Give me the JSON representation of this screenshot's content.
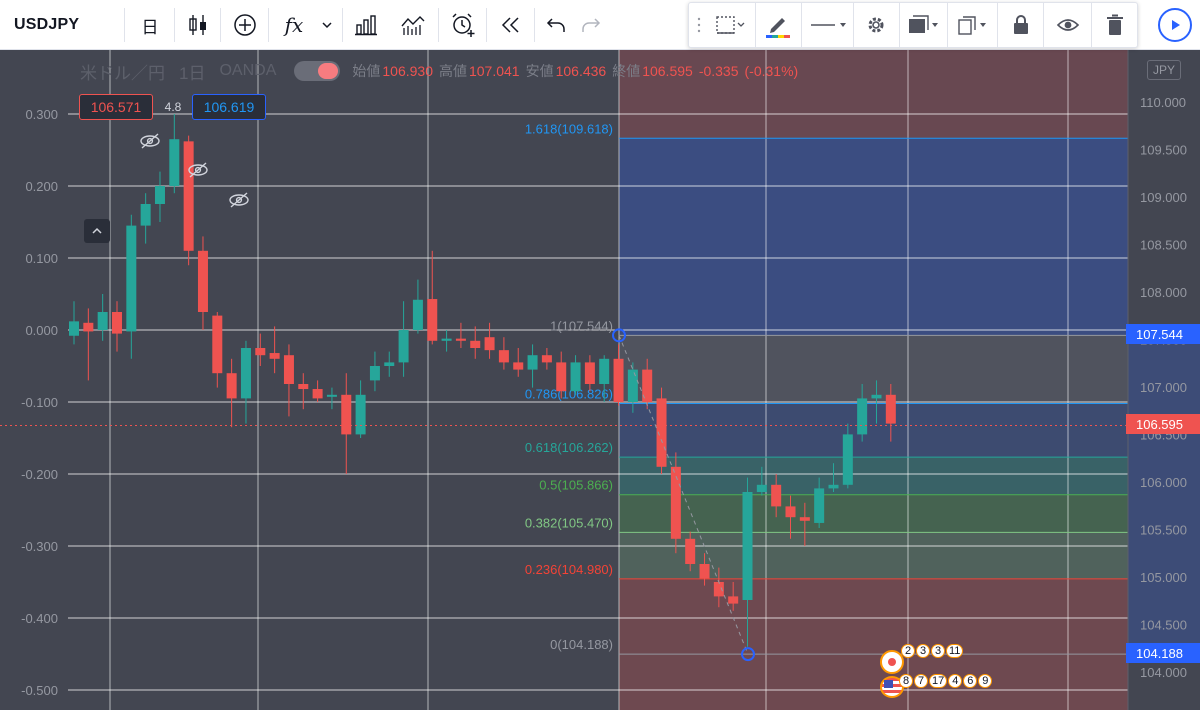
{
  "toolbar": {
    "symbol": "USDJPY",
    "interval": "日",
    "fx_label": "fx"
  },
  "legend": {
    "pair": "米ドル／円",
    "interval": "1日",
    "broker": "OANDA",
    "open_key": "始値",
    "open": "106.930",
    "high_key": "高値",
    "high": "107.041",
    "low_key": "安値",
    "low": "106.436",
    "close_key": "終値",
    "close": "106.595",
    "change": "-0.335",
    "change_pct": "(-0.31%)"
  },
  "order": {
    "sell": "106.571",
    "spread": "4.8",
    "buy": "106.619"
  },
  "left_axis": [
    "0.300",
    "0.200",
    "0.100",
    "0.000",
    "-0.100",
    "-0.200",
    "-0.300",
    "-0.400",
    "-0.500"
  ],
  "right_axis": [
    "110.000",
    "109.500",
    "109.000",
    "108.500",
    "108.000",
    "107.500",
    "107.000",
    "106.500",
    "106.000",
    "105.500",
    "105.000",
    "104.500",
    "104.000"
  ],
  "right_axis_currency": "JPY",
  "axis_badges": {
    "fib_top": "107.544",
    "last_price": "106.595",
    "fib_bottom": "104.188"
  },
  "fib_levels": [
    {
      "label": "1.618(109.618)",
      "ratio": 1.618,
      "price": 109.618,
      "color": "#2196f3"
    },
    {
      "label": "1(107.544)",
      "ratio": 1,
      "price": 107.544,
      "color": "#9598a1"
    },
    {
      "label": "0.786(106.826)",
      "ratio": 0.786,
      "price": 106.826,
      "color": "#2196f3"
    },
    {
      "label": "0.618(106.262)",
      "ratio": 0.618,
      "price": 106.262,
      "color": "#26a69a"
    },
    {
      "label": "0.5(105.866)",
      "ratio": 0.5,
      "price": 105.866,
      "color": "#4caf50"
    },
    {
      "label": "0.382(105.470)",
      "ratio": 0.382,
      "price": 105.47,
      "color": "#81c784"
    },
    {
      "label": "0.236(104.980)",
      "ratio": 0.236,
      "price": 104.98,
      "color": "#f44336"
    },
    {
      "label": "0(104.188)",
      "ratio": 0,
      "price": 104.188,
      "color": "#9598a1"
    }
  ],
  "event_badges": {
    "top_row": [
      "2",
      "3",
      "3",
      "11"
    ],
    "bottom_row": [
      "8",
      "7",
      "17",
      "4",
      "6",
      "9"
    ]
  },
  "colors": {
    "up": "#26a69a",
    "down": "#ef5350",
    "accent": "#2962ff",
    "background": "#434651"
  },
  "icons": {
    "candles": "candle-icon",
    "add_indicator": "plus-circle-icon",
    "fx": "fx-icon",
    "bar_chart": "bar-chart-icon",
    "compare": "compare-icon",
    "alert": "alarm-icon",
    "replay": "rewind-icon",
    "undo": "undo-icon",
    "redo": "redo-icon"
  }
}
